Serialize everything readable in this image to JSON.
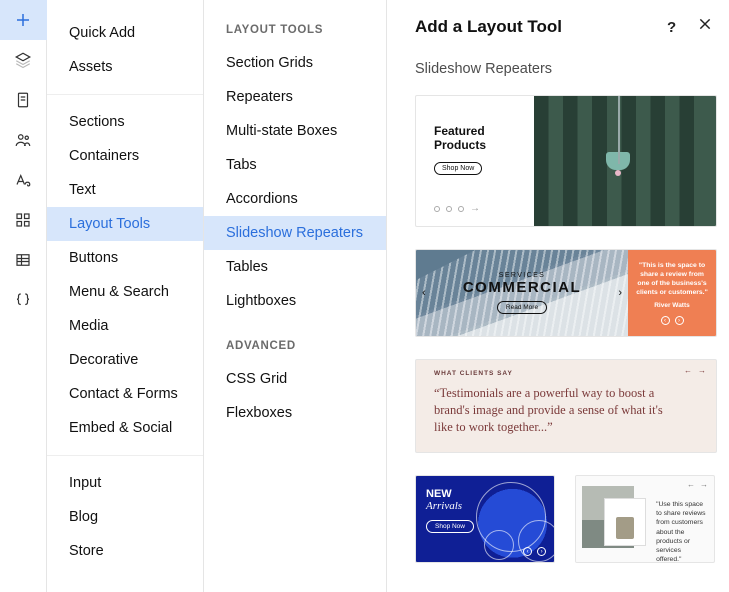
{
  "rail_icons": [
    "plus",
    "layers",
    "page",
    "people",
    "font",
    "grid",
    "table",
    "braces"
  ],
  "col1_groups": [
    {
      "items": [
        "Quick Add",
        "Assets"
      ]
    },
    {
      "items": [
        "Sections",
        "Containers",
        "Text",
        "Layout Tools",
        "Buttons",
        "Menu & Search",
        "Media",
        "Decorative",
        "Contact & Forms",
        "Embed & Social"
      ],
      "selected_index": 3
    },
    {
      "items": [
        "Input",
        "Blog",
        "Store"
      ]
    }
  ],
  "col2": {
    "sections": [
      {
        "heading": "LAYOUT TOOLS",
        "items": [
          "Section Grids",
          "Repeaters",
          "Multi-state Boxes",
          "Tabs",
          "Accordions",
          "Slideshow Repeaters",
          "Tables",
          "Lightboxes"
        ],
        "selected_index": 5
      },
      {
        "heading": "ADVANCED",
        "items": [
          "CSS Grid",
          "Flexboxes"
        ]
      }
    ]
  },
  "panel": {
    "title": "Add a Layout Tool",
    "section_label": "Slideshow Repeaters",
    "card_a": {
      "title_line1": "Featured",
      "title_line2": "Products",
      "button": "Shop Now"
    },
    "card_b": {
      "kicker": "SERVICES",
      "headline": "COMMERCIAL",
      "button": "Read More",
      "quote": "\"This is the space to share a review from one of the business's clients or customers.\"",
      "author": "River Watts"
    },
    "card_c": {
      "kicker": "WHAT CLIENTS SAY",
      "quote": "“Testimonials are a powerful way to boost a brand's image and provide a sense of what it's like to work together...”"
    },
    "card_d": {
      "line1": "NEW",
      "line2": "Arrivals",
      "button": "Shop Now"
    },
    "card_e": {
      "text": "\"Use this space to share reviews from customers about the products or services offered.\""
    }
  }
}
